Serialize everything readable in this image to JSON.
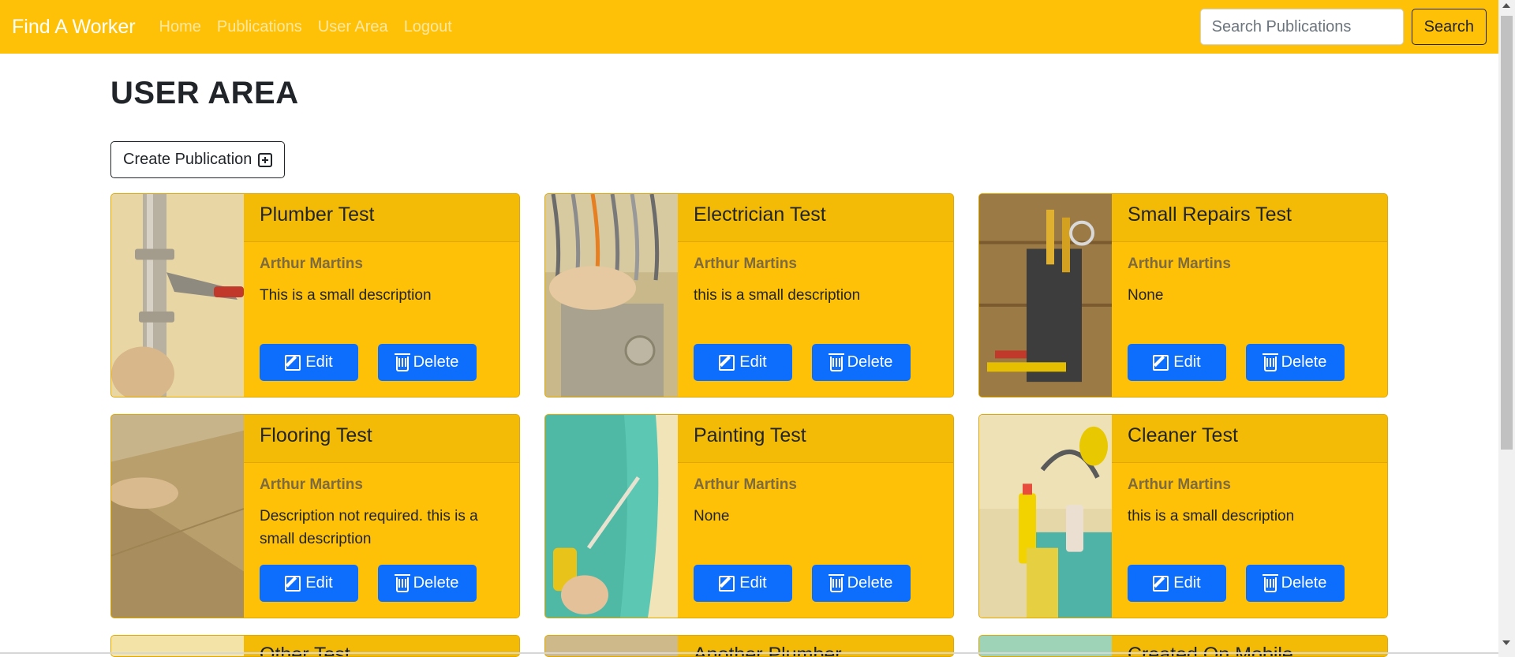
{
  "navbar": {
    "brand": "Find A Worker",
    "links": [
      "Home",
      "Publications",
      "User Area",
      "Logout"
    ],
    "search_placeholder": "Search Publications",
    "search_button": "Search"
  },
  "page": {
    "title": "USER AREA",
    "create_button": "Create Publication"
  },
  "colors": {
    "navbar": "#ffc107",
    "card": "#ffc107",
    "button": "#0d6efd"
  },
  "cards": [
    {
      "title": "Plumber Test",
      "author": "Arthur Martins",
      "description": "This is a small description",
      "edit": "Edit",
      "delete": "Delete",
      "image": "plumber-pipe-wrench"
    },
    {
      "title": "Electrician Test",
      "author": "Arthur Martins",
      "description": "this is a small description",
      "edit": "Edit",
      "delete": "Delete",
      "image": "electrician-wires"
    },
    {
      "title": "Small Repairs Test",
      "author": "Arthur Martins",
      "description": "None",
      "edit": "Edit",
      "delete": "Delete",
      "image": "toolbox"
    },
    {
      "title": "Flooring Test",
      "author": "Arthur Martins",
      "description": "Description not required. this is a small description",
      "edit": "Edit",
      "delete": "Delete",
      "image": "floor-board"
    },
    {
      "title": "Painting Test",
      "author": "Arthur Martins",
      "description": "None",
      "edit": "Edit",
      "delete": "Delete",
      "image": "paint-roller"
    },
    {
      "title": "Cleaner Test",
      "author": "Arthur Martins",
      "description": "this is a small description",
      "edit": "Edit",
      "delete": "Delete",
      "image": "cleaning-bucket"
    },
    {
      "title": "Other Test",
      "image": "other"
    },
    {
      "title": "Another Plumber",
      "image": "plumber"
    },
    {
      "title": "Created On Mobile",
      "image": "mobile"
    }
  ]
}
